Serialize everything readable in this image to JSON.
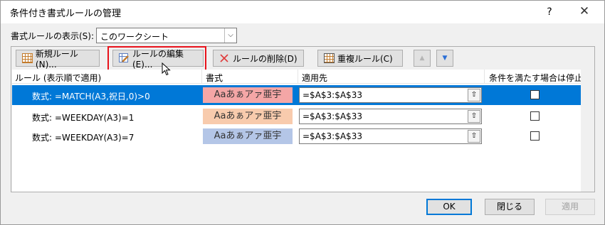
{
  "window": {
    "title": "条件付き書式ルールの管理",
    "help": "?",
    "close": "✕"
  },
  "scope": {
    "label": "書式ルールの表示(S):",
    "value": "このワークシート"
  },
  "toolbar": {
    "new_rule": "新規ルール(N)...",
    "edit_rule": "ルールの編集(E)...",
    "delete_rule": "ルールの削除(D)",
    "duplicate_rule": "重複ルール(C)",
    "move_up": "▲",
    "move_down": "▼"
  },
  "table": {
    "headers": {
      "rule": "ルール (表示順で適用)",
      "format": "書式",
      "applies_to": "適用先",
      "stop_if_true": "条件を満たす場合は停止"
    },
    "rows": [
      {
        "rule": "数式: =MATCH(A3,祝日,0)>0",
        "preview": "Aaあぁアァ亜宇",
        "preview_bg": "#f4a6a6",
        "applies_to": "=$A$3:$A$33",
        "stop": false,
        "selected": true
      },
      {
        "rule": "数式: =WEEKDAY(A3)=1",
        "preview": "Aaあぁアァ亜宇",
        "preview_bg": "#f8cbad",
        "applies_to": "=$A$3:$A$33",
        "stop": false,
        "selected": false
      },
      {
        "rule": "数式: =WEEKDAY(A3)=7",
        "preview": "Aaあぁアァ亜宇",
        "preview_bg": "#b4c6e7",
        "applies_to": "=$A$3:$A$33",
        "stop": false,
        "selected": false
      }
    ],
    "collapse_icon": "⇧"
  },
  "footer": {
    "ok": "OK",
    "close": "閉じる",
    "apply": "適用"
  }
}
